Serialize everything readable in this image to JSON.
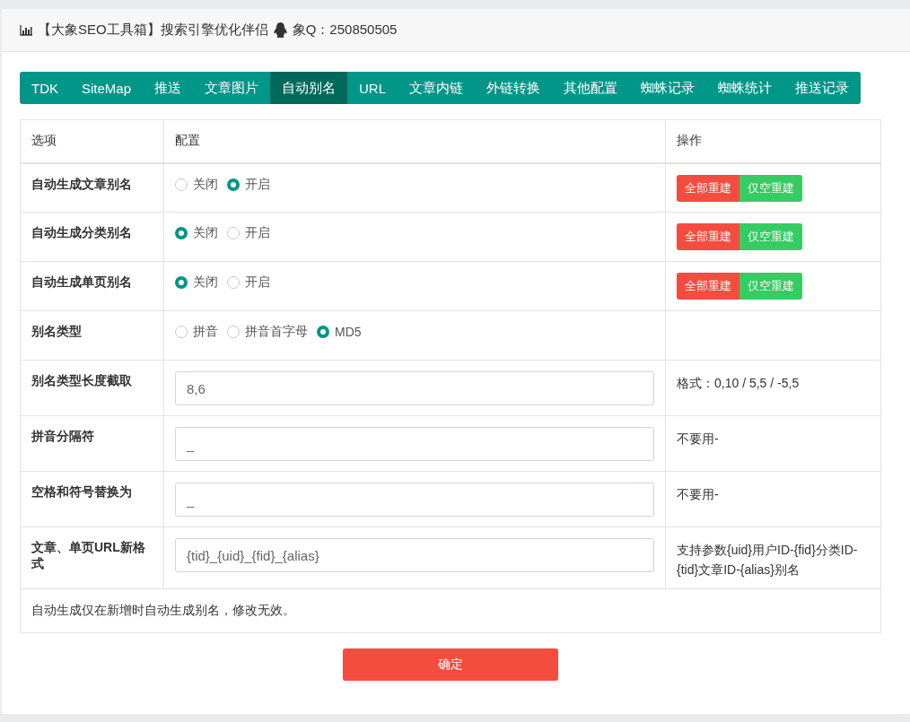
{
  "header": {
    "title": "【大象SEO工具箱】搜索引擎优化伴侣",
    "qq": "象Q：250850505"
  },
  "tabs": [
    {
      "label": "TDK",
      "selected": false
    },
    {
      "label": "SiteMap",
      "selected": false
    },
    {
      "label": "推送",
      "selected": false
    },
    {
      "label": "文章图片",
      "selected": false
    },
    {
      "label": "自动别名",
      "selected": true
    },
    {
      "label": "URL",
      "selected": false
    },
    {
      "label": "文章内链",
      "selected": false
    },
    {
      "label": "外链转换",
      "selected": false
    },
    {
      "label": "其他配置",
      "selected": false
    },
    {
      "label": "蜘蛛记录",
      "selected": false
    },
    {
      "label": "蜘蛛统计",
      "selected": false
    },
    {
      "label": "推送记录",
      "selected": false
    }
  ],
  "table": {
    "columns": [
      "选项",
      "配置",
      "操作"
    ],
    "rows": [
      {
        "label": "自动生成文章别名",
        "kind": "radio",
        "options": [
          {
            "label": "关闭",
            "selected": false
          },
          {
            "label": "开启",
            "selected": true
          }
        ],
        "buttons": [
          {
            "label": "全部重建",
            "kind": "danger"
          },
          {
            "label": "仅空重建",
            "kind": "success"
          }
        ]
      },
      {
        "label": "自动生成分类别名",
        "kind": "radio",
        "options": [
          {
            "label": "关闭",
            "selected": true
          },
          {
            "label": "开启",
            "selected": false
          }
        ],
        "buttons": [
          {
            "label": "全部重建",
            "kind": "danger"
          },
          {
            "label": "仅空重建",
            "kind": "success"
          }
        ]
      },
      {
        "label": "自动生成单页别名",
        "kind": "radio",
        "options": [
          {
            "label": "关闭",
            "selected": true
          },
          {
            "label": "开启",
            "selected": false
          }
        ],
        "buttons": [
          {
            "label": "全部重建",
            "kind": "danger"
          },
          {
            "label": "仅空重建",
            "kind": "success"
          }
        ]
      },
      {
        "label": "别名类型",
        "kind": "radio",
        "options": [
          {
            "label": "拼音",
            "selected": false
          },
          {
            "label": "拼音首字母",
            "selected": false
          },
          {
            "label": "MD5",
            "selected": true
          }
        ]
      },
      {
        "label": "别名类型长度截取",
        "kind": "input",
        "value": "8,6",
        "note": "格式：0,10 / 5,5 / -5,5"
      },
      {
        "label": "拼音分隔符",
        "kind": "input",
        "value": "_",
        "note": "不要用-"
      },
      {
        "label": "空格和符号替换为",
        "kind": "input",
        "value": "_",
        "note": "不要用-"
      },
      {
        "label": "文章、单页URL新格式",
        "kind": "input",
        "value": "{tid}_{uid}_{fid}_{alias}",
        "note": "支持参数{uid}用户ID-{fid}分类ID-{tid}文章ID-{alias}别名"
      }
    ],
    "footnote": "自动生成仅在新增时自动生成别名，修改无效。"
  },
  "submit": "确定"
}
